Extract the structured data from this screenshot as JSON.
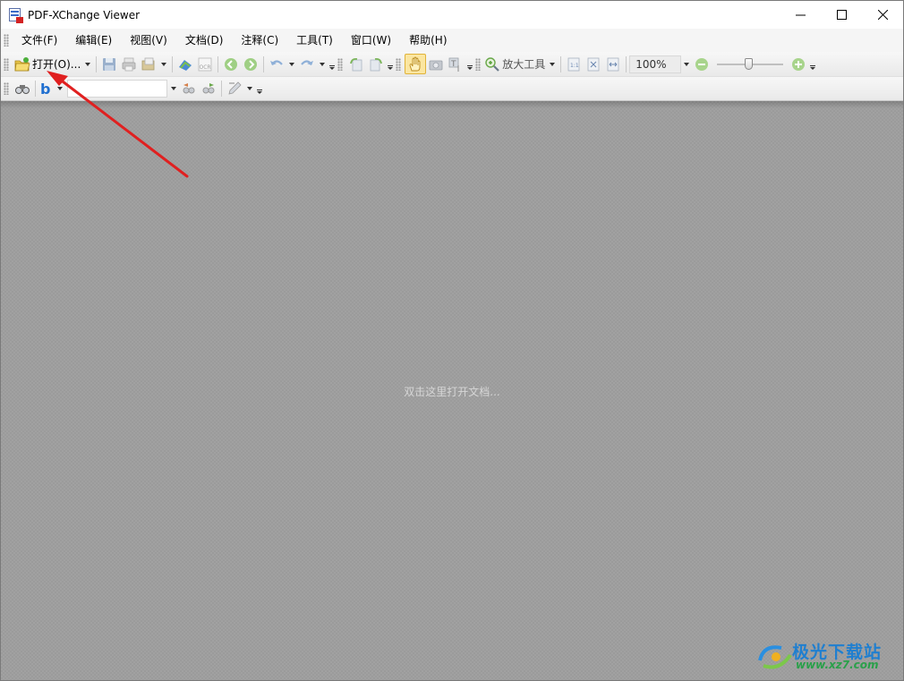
{
  "window": {
    "title": "PDF-XChange Viewer"
  },
  "menu": {
    "items": [
      "文件(F)",
      "编辑(E)",
      "视图(V)",
      "文档(D)",
      "注释(C)",
      "工具(T)",
      "窗口(W)",
      "帮助(H)"
    ]
  },
  "toolbar": {
    "open_label": "打开(O)...",
    "zoom_tool_label": "放大工具",
    "zoom_value": "100%",
    "ocr_label": "OCR",
    "search_value": ""
  },
  "workspace": {
    "hint": "双击这里打开文档..."
  },
  "watermark": {
    "title": "极光下载站",
    "url": "www.xz7.com"
  },
  "colors": {
    "annotation_arrow": "#e02020",
    "hand_tool_active": "#fbe6a1",
    "workspace": "#9b9b9b"
  }
}
